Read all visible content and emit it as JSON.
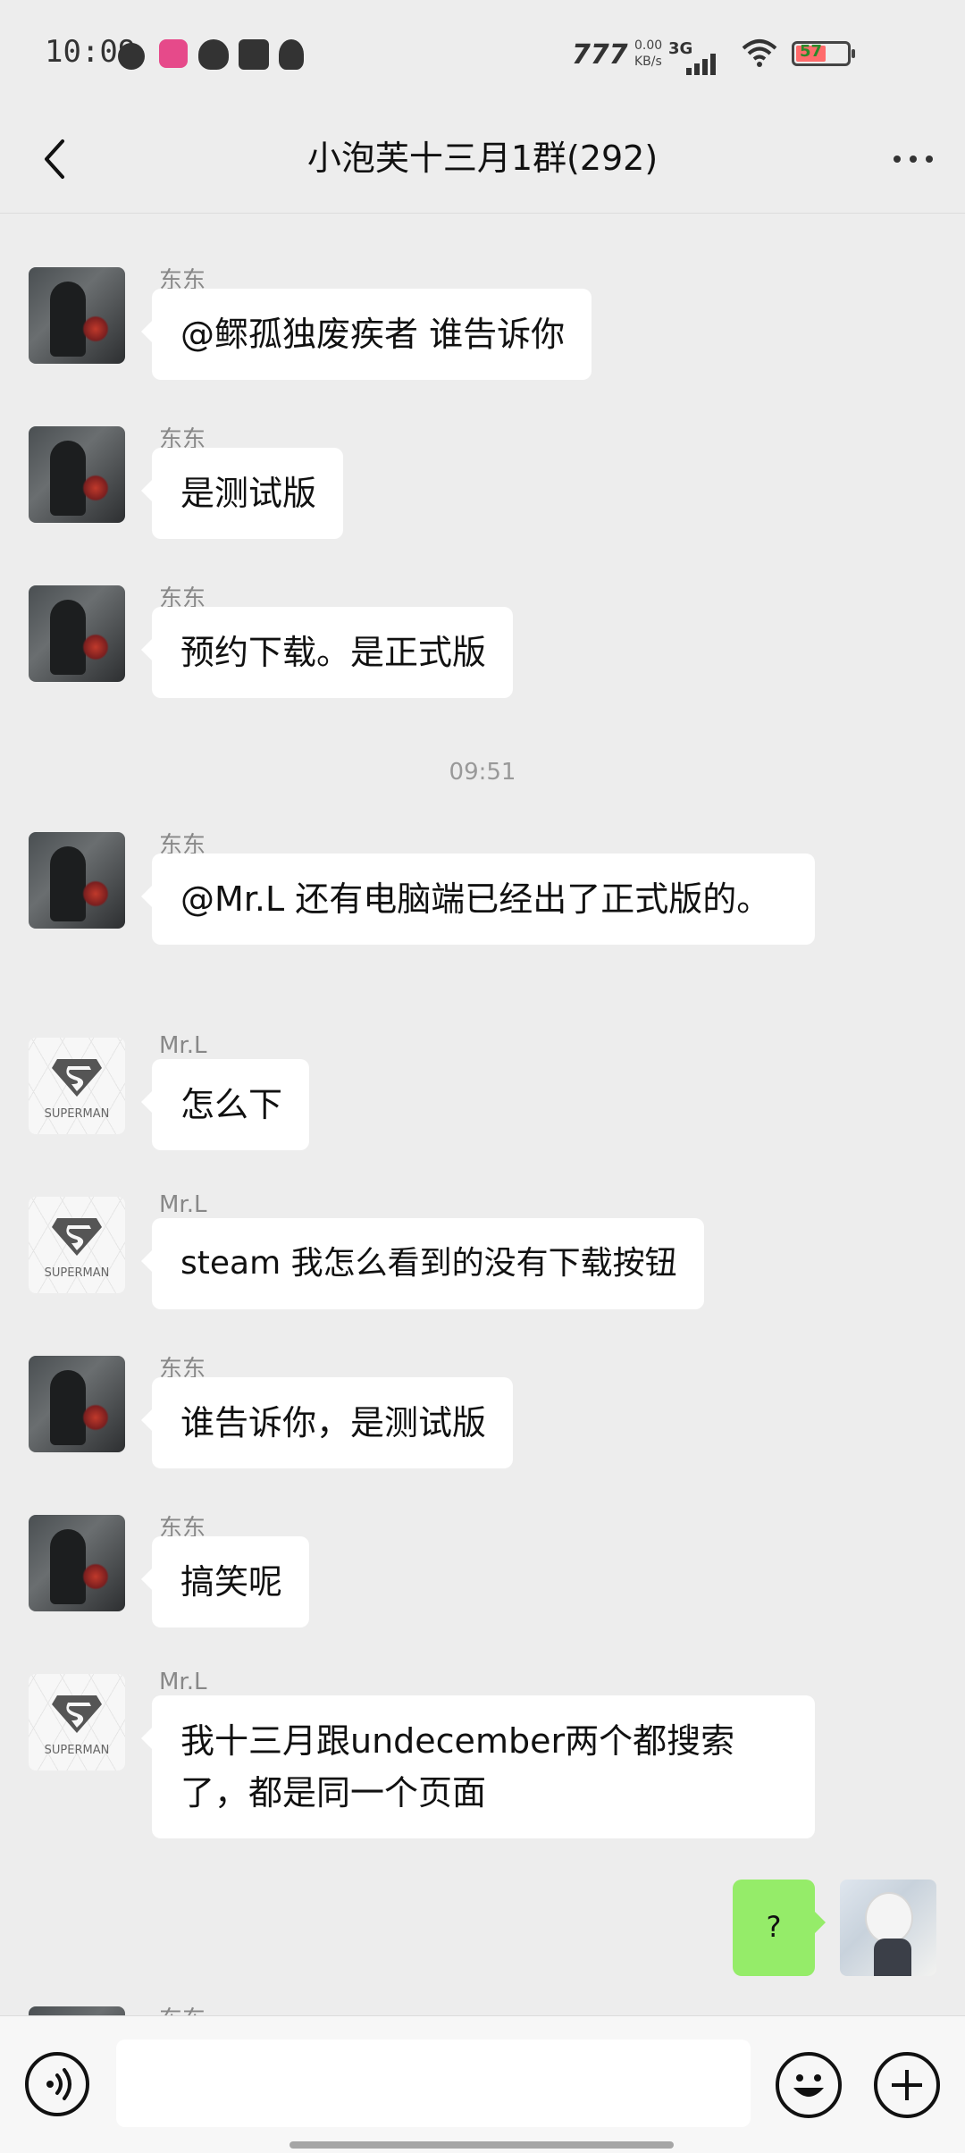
{
  "status_bar": {
    "time": "10:09",
    "net_label": "777",
    "speed_value": "0.00",
    "speed_unit": "KB/s",
    "network_type": "3G",
    "battery": "57"
  },
  "header": {
    "title": "小泡芙十三月1群(292)",
    "back_icon": "chevron-left-icon",
    "more_icon": "more-dots-icon"
  },
  "chat": {
    "timestamps": [
      "09:51"
    ],
    "messages": [
      {
        "sender": "东东",
        "avatar": "dongdong",
        "text": "@鳏孤独废疾者 谁告诉你"
      },
      {
        "sender": "东东",
        "avatar": "dongdong",
        "text": "是测试版"
      },
      {
        "sender": "东东",
        "avatar": "dongdong",
        "text": "预约下载。是正式版"
      },
      {
        "sender": "东东",
        "avatar": "dongdong",
        "text": "@Mr.L 还有电脑端已经出了正式版的。"
      },
      {
        "sender": "Mr.L",
        "avatar": "superman",
        "text": "怎么下"
      },
      {
        "sender": "Mr.L",
        "avatar": "superman",
        "text": "steam 我怎么看到的没有下载按钮"
      },
      {
        "sender": "东东",
        "avatar": "dongdong",
        "text": "谁告诉你，是测试版"
      },
      {
        "sender": "东东",
        "avatar": "dongdong",
        "text": "搞笑呢"
      },
      {
        "sender": "Mr.L",
        "avatar": "superman",
        "text": "我十三月跟undecember两个都搜索了，都是同一个页面"
      },
      {
        "sender": "me",
        "avatar": "me",
        "text": "?"
      },
      {
        "sender": "东东",
        "avatar": "dongdong",
        "text": ""
      }
    ],
    "superman_label": "SUPERMAN"
  },
  "input_bar": {
    "voice_icon": "voice-icon",
    "emoji_icon": "emoji-icon",
    "plus_icon": "plus-icon",
    "text_value": ""
  },
  "colors": {
    "background": "#ededed",
    "own_bubble": "#95ec69",
    "other_bubble": "#ffffff"
  }
}
